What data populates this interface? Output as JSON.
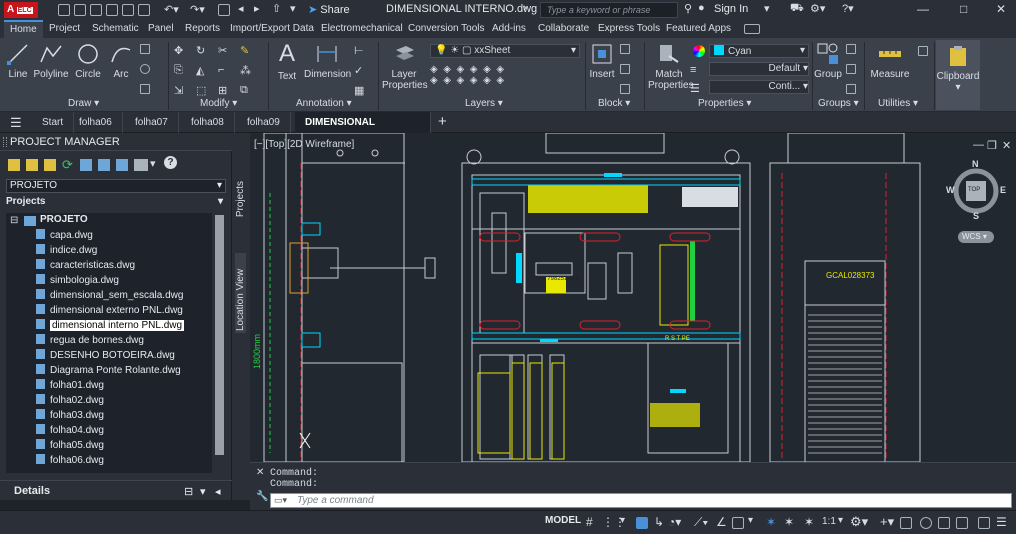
{
  "titlebar": {
    "app_badge": "A",
    "doc_title": "DIMENSIONAL INTERNO.dwg",
    "share_label": "Share",
    "search_placeholder": "Type a keyword or phrase",
    "sign_in": "Sign In"
  },
  "menu": {
    "tabs": [
      "Home",
      "Project",
      "Schematic",
      "Panel",
      "Reports",
      "Import/Export Data",
      "Electromechanical",
      "Conversion Tools",
      "Add-ins",
      "Collaborate",
      "Express Tools",
      "Featured Apps"
    ],
    "active": "Home"
  },
  "ribbon": {
    "draw": {
      "line": "Line",
      "polyline": "Polyline",
      "circle": "Circle",
      "arc": "Arc",
      "panel": "Draw"
    },
    "modify": {
      "panel": "Modify"
    },
    "annotation": {
      "text": "Text",
      "dimension": "Dimension",
      "panel": "Annotation"
    },
    "layers": {
      "layer_properties_1": "Layer",
      "layer_properties_2": "Properties",
      "layer_value": "xxSheet",
      "panel": "Layers"
    },
    "block": {
      "insert": "Insert",
      "panel": "Block"
    },
    "properties": {
      "match_1": "Match",
      "match_2": "Properties",
      "color_value": "Cyan",
      "linetype_value": "Default",
      "lineweight_value": "Conti...",
      "panel": "Properties"
    },
    "groups": {
      "group": "Group",
      "panel": "Groups"
    },
    "utilities": {
      "measure": "Measure",
      "panel": "Utilities"
    },
    "clipboard": {
      "label": "Clipboard"
    }
  },
  "doc_tabs": [
    "Start",
    "folha06",
    "folha07",
    "folha08",
    "folha09",
    "DIMENSIONAL INTERNO*"
  ],
  "project_manager": {
    "title": "PROJECT MANAGER",
    "project_select": "PROJETO",
    "projects_label": "Projects",
    "root": "PROJETO",
    "files": [
      "capa.dwg",
      "indice.dwg",
      "caracteristicas.dwg",
      "simbologia.dwg",
      "dimensional_sem_escala.dwg",
      "dimensional externo PNL.dwg",
      "dimensional interno PNL.dwg",
      "regua de bornes.dwg",
      "DESENHO BOTOEIRA.dwg",
      "Diagrama Ponte Rolante.dwg",
      "folha01.dwg",
      "folha02.dwg",
      "folha03.dwg",
      "folha04.dwg",
      "folha05.dwg",
      "folha06.dwg"
    ],
    "selected_file": "dimensional interno PNL.dwg",
    "details_label": "Details"
  },
  "side_tabs": {
    "projects": "Projects",
    "location": "Location View"
  },
  "viewport": {
    "label": "[−][Top][2D Wireframe]",
    "viewcube": {
      "top": "TOP",
      "n": "N",
      "s": "S",
      "e": "E",
      "w": "W",
      "wcs": "WCS"
    },
    "drawing_text": {
      "dim": "1800mm",
      "door_label": "GCAL028373",
      "rst": "R  S  T  PE",
      "terminal": "HD 798251-9x8"
    }
  },
  "command": {
    "line1": "Command:",
    "line2": "Command:",
    "placeholder": "Type a command"
  },
  "status": {
    "model": "MODEL",
    "scale": "1:1"
  },
  "colors": {
    "accent": "#4a90d9",
    "yellow": "#e8e800",
    "cyan": "#00d8ff",
    "red": "#e0202a",
    "green": "#20d040"
  }
}
